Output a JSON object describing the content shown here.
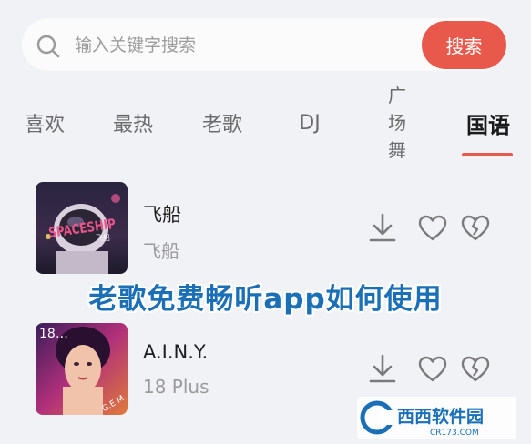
{
  "search": {
    "placeholder": "输入关键字搜索",
    "button_label": "搜索"
  },
  "tabs": [
    {
      "label": "喜欢",
      "active": false
    },
    {
      "label": "最热",
      "active": false
    },
    {
      "label": "老歌",
      "active": false
    },
    {
      "label": "DJ",
      "active": false
    },
    {
      "label": "广场舞",
      "active": false
    },
    {
      "label": "国语",
      "active": true
    }
  ],
  "songs": [
    {
      "title": "飞船",
      "artist": "飞船",
      "cover_text": "SPACESHIP",
      "cover_sub": "飞船"
    },
    {
      "title": "A.I.N.Y.",
      "artist": "18 Plus",
      "cover_text": "18…",
      "cover_sub": "G.E.M."
    }
  ],
  "actions": [
    "download-icon",
    "heart-icon",
    "broken-heart-icon"
  ],
  "overlay": {
    "caption": "老歌免费畅听app如何使用",
    "logo_text": "西西软件园",
    "logo_sub": "CR173.COM"
  },
  "colors": {
    "accent": "#e8594b",
    "background": "#f1f2f5",
    "caption": "#1b6fb6"
  }
}
